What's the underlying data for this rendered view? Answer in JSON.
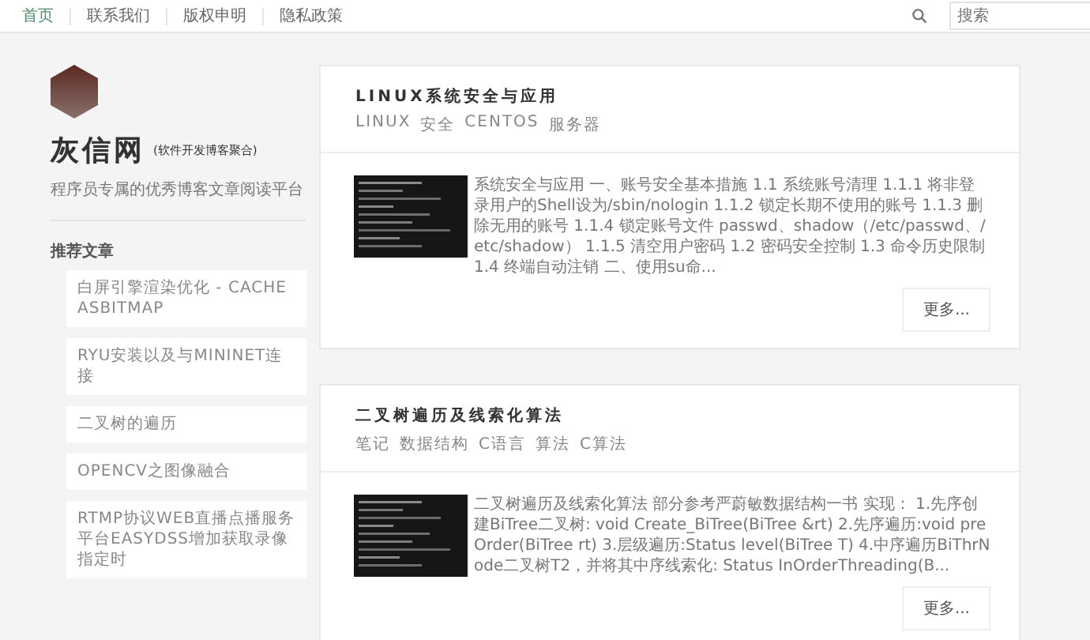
{
  "nav": {
    "items": [
      {
        "label": "首页",
        "selected": true
      },
      {
        "label": "联系我们",
        "selected": false
      },
      {
        "label": "版权申明",
        "selected": false
      },
      {
        "label": "隐私政策",
        "selected": false
      }
    ],
    "search": {
      "placeholder": "搜索"
    }
  },
  "sidebar": {
    "site_name": "灰信网",
    "site_note": "(软件开发博客聚合)",
    "tagline": "程序员专属的优秀博客文章阅读平台",
    "section_title": "推荐文章",
    "articles": [
      "白屏引擎渲染优化 - CACHEASBITMAP",
      "RYU安装以及与MININET连接",
      "二叉树的遍历",
      "OPENCV之图像融合",
      "RTMP协议WEB直播点播服务平台EASYDSS增加获取录像指定时"
    ]
  },
  "posts": [
    {
      "title": "LINUX系统安全与应用",
      "tags": [
        "LINUX",
        "安全",
        "CENTOS",
        "服务器"
      ],
      "excerpt": "系统安全与应用 一、账号安全基本措施 1.1 系统账号清理 1.1.1 将非登录用户的Shell设为/sbin/nologin 1.1.2 锁定长期不使用的账号 1.1.3 删除无用的账号 1.1.4 锁定账号文件 passwd、shadow（/etc/passwd、/etc/shadow） 1.1.5 清空用户密码 1.2 密码安全控制 1.3 命令历史限制 1.4 终端自动注销 二、使用su命...",
      "more": "更多..."
    },
    {
      "title": "二叉树遍历及线索化算法",
      "tags": [
        "笔记",
        "数据结构",
        "C语言",
        "算法",
        "C算法"
      ],
      "excerpt": "二叉树遍历及线索化算法 部分参考严蔚敏数据结构一书 实现： 1.先序创建BiTree二叉树: void Create_BiTree(BiTree &rt) 2.先序遍历:void preOrder(BiTree rt) 3.层级遍历:Status level(BiTree T) 4.中序遍历BiThrNode二叉树T2，并将其中序线索化: Status InOrderThreading(B...",
      "more": "更多..."
    }
  ]
}
